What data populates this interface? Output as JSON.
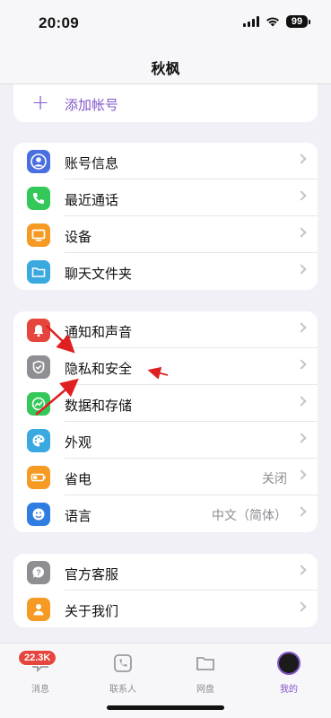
{
  "status_bar": {
    "time": "20:09",
    "battery": "99"
  },
  "header": {
    "title": "秋枫"
  },
  "add_account": {
    "label": "添加帐号"
  },
  "group1": [
    {
      "label": "账号信息",
      "icon": "user-icon",
      "color": "#4a6fe0"
    },
    {
      "label": "最近通话",
      "icon": "phone-icon",
      "color": "#34c759"
    },
    {
      "label": "设备",
      "icon": "desktop-icon",
      "color": "#f59a23"
    },
    {
      "label": "聊天文件夹",
      "icon": "folder-icon",
      "color": "#3aa9e0"
    }
  ],
  "group2": [
    {
      "label": "通知和声音",
      "icon": "bell-icon",
      "color": "#e5453c",
      "value": ""
    },
    {
      "label": "隐私和安全",
      "icon": "shield-icon",
      "color": "#8e8e93",
      "value": ""
    },
    {
      "label": "数据和存储",
      "icon": "chart-icon",
      "color": "#34c759",
      "value": ""
    },
    {
      "label": "外观",
      "icon": "palette-icon",
      "color": "#3aa9e0",
      "value": ""
    },
    {
      "label": "省电",
      "icon": "battery-icon",
      "color": "#f59a23",
      "value": "关闭"
    },
    {
      "label": "语言",
      "icon": "globe-icon",
      "color": "#2f7de0",
      "value": "中文（简体）"
    }
  ],
  "group3": [
    {
      "label": "官方客服",
      "icon": "question-icon",
      "color": "#8e8e93"
    },
    {
      "label": "关于我们",
      "icon": "info-icon",
      "color": "#f59a23"
    }
  ],
  "tab_bar": {
    "badge": "22.3K",
    "tabs": [
      {
        "label": "消息",
        "icon": "chat-icon"
      },
      {
        "label": "联系人",
        "icon": "contacts-icon"
      },
      {
        "label": "网盘",
        "icon": "folder-icon"
      },
      {
        "label": "我的",
        "icon": "avatar-icon",
        "active": true
      }
    ]
  },
  "colors": {
    "accent": "#8257c9",
    "arrow": "#e02020",
    "background": "#f1f0f6"
  }
}
